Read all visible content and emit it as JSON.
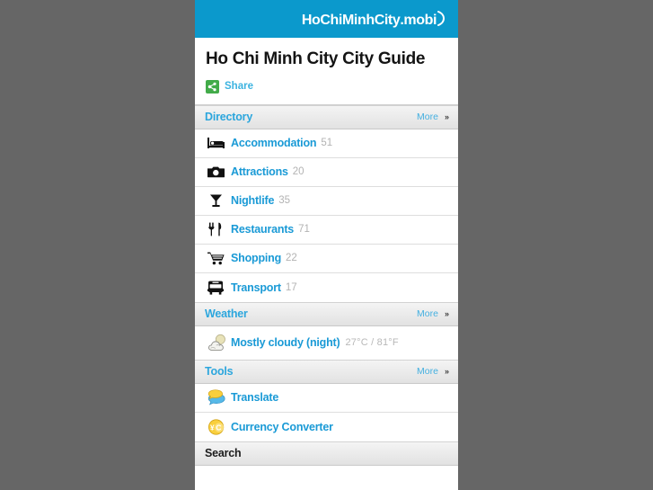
{
  "header": {
    "logo_main": "HoChiMinhCity",
    "logo_tld": ".mobi",
    "logo_icon": "swoosh-icon",
    "background_color": "#0b99cc"
  },
  "title_block": {
    "page_title": "Ho Chi Minh City City Guide",
    "share_label": "Share",
    "share_icon": "share-icon",
    "share_icon_color": "#42ab49"
  },
  "sections": [
    {
      "id": "directory",
      "title": "Directory",
      "more_label": "More",
      "more_chevron": "»",
      "items": [
        {
          "icon": "bed-icon",
          "label": "Accommodation",
          "count": "51"
        },
        {
          "icon": "camera-icon",
          "label": "Attractions",
          "count": "20"
        },
        {
          "icon": "cocktail-icon",
          "label": "Nightlife",
          "count": "35"
        },
        {
          "icon": "cutlery-icon",
          "label": "Restaurants",
          "count": "71"
        },
        {
          "icon": "cart-icon",
          "label": "Shopping",
          "count": "22"
        },
        {
          "icon": "bus-icon",
          "label": "Transport",
          "count": "17"
        }
      ]
    },
    {
      "id": "weather",
      "title": "Weather",
      "more_label": "More",
      "more_chevron": "»",
      "items": [
        {
          "icon": "cloud-moon-icon",
          "label": "Mostly cloudy (night)",
          "meta": "27°C / 81°F"
        }
      ]
    },
    {
      "id": "tools",
      "title": "Tools",
      "more_label": "More",
      "more_chevron": "»",
      "items": [
        {
          "icon": "translate-icon",
          "label": "Translate"
        },
        {
          "icon": "currency-icon",
          "label": "Currency Converter"
        }
      ]
    },
    {
      "id": "search",
      "title": "Search",
      "items": []
    }
  ],
  "colors": {
    "brand_blue": "#0b99cc",
    "link_blue": "#1a9ad6",
    "section_title_blue": "#2ca6dd",
    "count_gray": "#b3b3b3",
    "page_background": "#666666"
  }
}
